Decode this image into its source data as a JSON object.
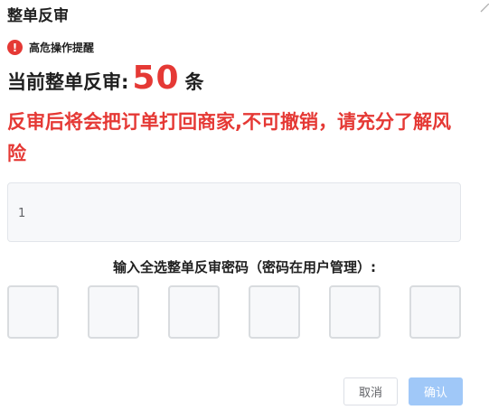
{
  "dialog": {
    "title": "整单反审",
    "alert_icon": "exclamation-circle-icon",
    "alert_text": "高危操作提醒",
    "count_label": "当前整单反审:",
    "count_value": "50",
    "count_unit": "条",
    "warning_text": "反审后将会把订单打回商家,不可撤销，请充分了解风险",
    "input_value": "1",
    "password_label": "输入全选整单反审密码（密码在用户管理）:",
    "password_digits": 6,
    "cancel_label": "取消",
    "confirm_label": "确认"
  },
  "colors": {
    "danger": "#e53935",
    "primary_disabled": "#a0c8f8"
  }
}
